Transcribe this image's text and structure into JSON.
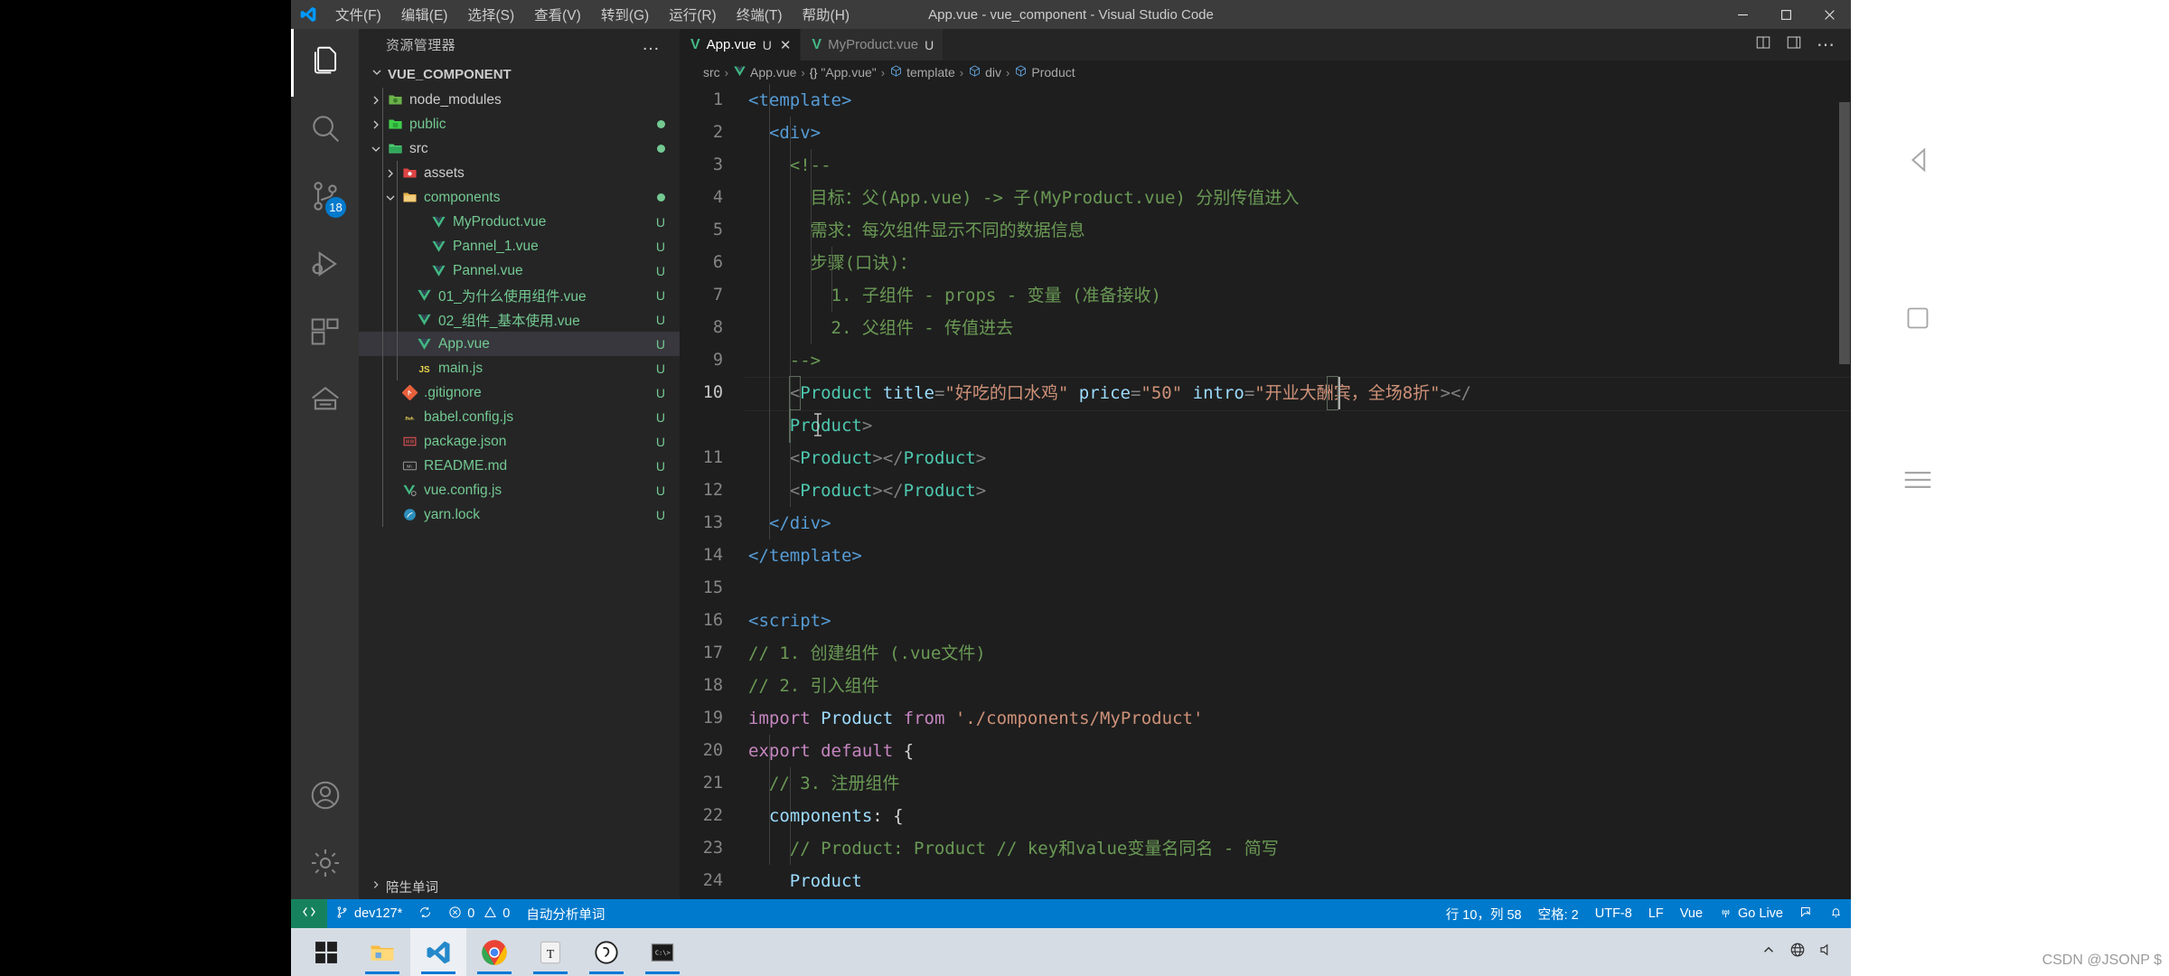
{
  "window": {
    "title": "App.vue - vue_component - Visual Studio Code",
    "menus": [
      "文件(F)",
      "编辑(E)",
      "选择(S)",
      "查看(V)",
      "转到(G)",
      "运行(R)",
      "终端(T)",
      "帮助(H)"
    ],
    "controls": {
      "minimize": "minimize-icon",
      "maximize": "maximize-icon",
      "close": "close-icon"
    }
  },
  "activitybar": {
    "items": [
      {
        "name": "explorer",
        "icon": "files-icon",
        "badge": ""
      },
      {
        "name": "search",
        "icon": "search-icon",
        "badge": ""
      },
      {
        "name": "source-control",
        "icon": "source-control-icon",
        "badge": "18"
      },
      {
        "name": "run-and-debug",
        "icon": "debug-icon",
        "badge": ""
      },
      {
        "name": "extensions",
        "icon": "extensions-icon",
        "badge": ""
      },
      {
        "name": "remote-explorer",
        "icon": "remote-icon",
        "badge": ""
      }
    ],
    "bottom": [
      {
        "name": "accounts",
        "icon": "account-icon"
      },
      {
        "name": "settings",
        "icon": "gear-icon"
      }
    ]
  },
  "sidebar": {
    "header": "资源管理器",
    "more": "…",
    "section": "VUE_COMPONENT",
    "footer": "陪生单词",
    "tree": [
      {
        "label": "node_modules",
        "indent": 1,
        "icon": "folder-node",
        "twisty": "right",
        "badge": "",
        "kind": "folder"
      },
      {
        "label": "public",
        "indent": 1,
        "icon": "folder-public",
        "twisty": "right",
        "badge": "dot",
        "kind": "folder"
      },
      {
        "label": "src",
        "indent": 1,
        "icon": "folder-src",
        "twisty": "down",
        "badge": "dot",
        "kind": "folder"
      },
      {
        "label": "assets",
        "indent": 2,
        "icon": "folder-assets",
        "twisty": "right",
        "badge": "",
        "kind": "folder"
      },
      {
        "label": "components",
        "indent": 2,
        "icon": "folder-components",
        "twisty": "down",
        "badge": "dot",
        "kind": "folder"
      },
      {
        "label": "MyProduct.vue",
        "indent": 4,
        "icon": "vue-icon",
        "twisty": "",
        "badge": "U",
        "kind": "file"
      },
      {
        "label": "Pannel_1.vue",
        "indent": 4,
        "icon": "vue-icon",
        "twisty": "",
        "badge": "U",
        "kind": "file"
      },
      {
        "label": "Pannel.vue",
        "indent": 4,
        "icon": "vue-icon",
        "twisty": "",
        "badge": "U",
        "kind": "file"
      },
      {
        "label": "01_为什么使用组件.vue",
        "indent": 3,
        "icon": "vue-icon",
        "twisty": "",
        "badge": "U",
        "kind": "file"
      },
      {
        "label": "02_组件_基本使用.vue",
        "indent": 3,
        "icon": "vue-icon",
        "twisty": "",
        "badge": "U",
        "kind": "file"
      },
      {
        "label": "App.vue",
        "indent": 3,
        "icon": "vue-icon",
        "twisty": "",
        "badge": "U",
        "kind": "file",
        "selected": true
      },
      {
        "label": "main.js",
        "indent": 3,
        "icon": "js-icon",
        "twisty": "",
        "badge": "U",
        "kind": "file"
      },
      {
        "label": ".gitignore",
        "indent": 2,
        "icon": "git-icon",
        "twisty": "",
        "badge": "U",
        "kind": "file"
      },
      {
        "label": "babel.config.js",
        "indent": 2,
        "icon": "babel-icon",
        "twisty": "",
        "badge": "U",
        "kind": "file"
      },
      {
        "label": "package.json",
        "indent": 2,
        "icon": "json-icon",
        "twisty": "",
        "badge": "U",
        "kind": "file"
      },
      {
        "label": "README.md",
        "indent": 2,
        "icon": "markdown-icon",
        "twisty": "",
        "badge": "U",
        "kind": "file"
      },
      {
        "label": "vue.config.js",
        "indent": 2,
        "icon": "vue-config-icon",
        "twisty": "",
        "badge": "U",
        "kind": "file"
      },
      {
        "label": "yarn.lock",
        "indent": 2,
        "icon": "yarn-icon",
        "twisty": "",
        "badge": "U",
        "kind": "file"
      }
    ]
  },
  "editor": {
    "tabs": [
      {
        "label": "App.vue",
        "badge": "U",
        "icon": "vue-icon",
        "active": true,
        "close": "✕"
      },
      {
        "label": "MyProduct.vue",
        "badge": "U",
        "icon": "vue-icon",
        "active": false,
        "close": ""
      }
    ],
    "tab_actions": [
      "split-editor-icon",
      "layout-panel-icon",
      "more-actions-icon"
    ],
    "breadcrumb": [
      "src",
      "App.vue",
      "{} \"App.vue\"",
      "template",
      "div",
      "Product"
    ],
    "lines": [
      {
        "n": 1,
        "tokens": [
          {
            "t": "tag",
            "v": "<template>"
          }
        ]
      },
      {
        "n": 2,
        "tokens": [
          {
            "t": "plain",
            "v": "  "
          },
          {
            "t": "tag",
            "v": "<div>"
          }
        ]
      },
      {
        "n": 3,
        "tokens": [
          {
            "t": "plain",
            "v": "    "
          },
          {
            "t": "comment",
            "v": "<!--"
          }
        ]
      },
      {
        "n": 4,
        "tokens": [
          {
            "t": "plain",
            "v": "      "
          },
          {
            "t": "comment",
            "v": "目标：父(App.vue) -> 子(MyProduct.vue) 分别传值进入"
          }
        ]
      },
      {
        "n": 5,
        "tokens": [
          {
            "t": "plain",
            "v": "      "
          },
          {
            "t": "comment",
            "v": "需求：每次组件显示不同的数据信息"
          }
        ]
      },
      {
        "n": 6,
        "tokens": [
          {
            "t": "plain",
            "v": "      "
          },
          {
            "t": "comment",
            "v": "步骤(口诀)："
          }
        ]
      },
      {
        "n": 7,
        "tokens": [
          {
            "t": "plain",
            "v": "        "
          },
          {
            "t": "comment",
            "v": "1. 子组件 - props - 变量 (准备接收)"
          }
        ]
      },
      {
        "n": 8,
        "tokens": [
          {
            "t": "plain",
            "v": "        "
          },
          {
            "t": "comment",
            "v": "2. 父组件 - 传值进去"
          }
        ]
      },
      {
        "n": 9,
        "tokens": [
          {
            "t": "plain",
            "v": "    "
          },
          {
            "t": "comment",
            "v": "-->"
          }
        ]
      },
      {
        "n": 10,
        "highlight": true,
        "wrapped": true,
        "tokens": [
          {
            "t": "plain",
            "v": "    "
          },
          {
            "t": "punct",
            "v": "<"
          },
          {
            "t": "comp",
            "v": "Product"
          },
          {
            "t": "plain",
            "v": " "
          },
          {
            "t": "attr",
            "v": "title"
          },
          {
            "t": "punct",
            "v": "="
          },
          {
            "t": "str",
            "v": "\"好吃的口水鸡\""
          },
          {
            "t": "plain",
            "v": " "
          },
          {
            "t": "attr",
            "v": "price"
          },
          {
            "t": "punct",
            "v": "="
          },
          {
            "t": "str",
            "v": "\"50\""
          },
          {
            "t": "plain",
            "v": " "
          },
          {
            "t": "attr",
            "v": "intro"
          },
          {
            "t": "punct",
            "v": "="
          },
          {
            "t": "str",
            "v": "\"开业大酬宾，全场8折\""
          },
          {
            "t": "punct",
            "v": ">"
          },
          {
            "t": "punct",
            "v": "</"
          }
        ],
        "wrap_tokens": [
          {
            "t": "plain",
            "v": "    "
          },
          {
            "t": "comp",
            "v": "Product"
          },
          {
            "t": "punct",
            "v": ">"
          }
        ]
      },
      {
        "n": 11,
        "tokens": [
          {
            "t": "plain",
            "v": "    "
          },
          {
            "t": "punct",
            "v": "<"
          },
          {
            "t": "comp",
            "v": "Product"
          },
          {
            "t": "punct",
            "v": "></"
          },
          {
            "t": "comp",
            "v": "Product"
          },
          {
            "t": "punct",
            "v": ">"
          }
        ]
      },
      {
        "n": 12,
        "tokens": [
          {
            "t": "plain",
            "v": "    "
          },
          {
            "t": "punct",
            "v": "<"
          },
          {
            "t": "comp",
            "v": "Product"
          },
          {
            "t": "punct",
            "v": "></"
          },
          {
            "t": "comp",
            "v": "Product"
          },
          {
            "t": "punct",
            "v": ">"
          }
        ]
      },
      {
        "n": 13,
        "tokens": [
          {
            "t": "plain",
            "v": "  "
          },
          {
            "t": "tag",
            "v": "</div>"
          }
        ]
      },
      {
        "n": 14,
        "tokens": [
          {
            "t": "tag",
            "v": "</template>"
          }
        ]
      },
      {
        "n": 15,
        "tokens": []
      },
      {
        "n": 16,
        "tokens": [
          {
            "t": "tag",
            "v": "<script>"
          }
        ]
      },
      {
        "n": 17,
        "tokens": [
          {
            "t": "comment",
            "v": "// 1. 创建组件 (.vue文件)"
          }
        ]
      },
      {
        "n": 18,
        "tokens": [
          {
            "t": "comment",
            "v": "// 2. 引入组件"
          }
        ]
      },
      {
        "n": 19,
        "tokens": [
          {
            "t": "kw",
            "v": "import"
          },
          {
            "t": "plain",
            "v": " "
          },
          {
            "t": "prop",
            "v": "Product"
          },
          {
            "t": "plain",
            "v": " "
          },
          {
            "t": "kw",
            "v": "from"
          },
          {
            "t": "plain",
            "v": " "
          },
          {
            "t": "str",
            "v": "'./components/MyProduct'"
          }
        ]
      },
      {
        "n": 20,
        "tokens": [
          {
            "t": "kw",
            "v": "export"
          },
          {
            "t": "plain",
            "v": " "
          },
          {
            "t": "kw",
            "v": "default"
          },
          {
            "t": "plain",
            "v": " {"
          }
        ]
      },
      {
        "n": 21,
        "tokens": [
          {
            "t": "plain",
            "v": "  "
          },
          {
            "t": "comment",
            "v": "// 3. 注册组件"
          }
        ]
      },
      {
        "n": 22,
        "tokens": [
          {
            "t": "plain",
            "v": "  "
          },
          {
            "t": "prop",
            "v": "components"
          },
          {
            "t": "plain",
            "v": ": {"
          }
        ]
      },
      {
        "n": 23,
        "tokens": [
          {
            "t": "plain",
            "v": "    "
          },
          {
            "t": "comment",
            "v": "// Product: Product // key和value变量名同名 - 简写"
          }
        ]
      },
      {
        "n": 24,
        "tokens": [
          {
            "t": "plain",
            "v": "    "
          },
          {
            "t": "prop",
            "v": "Product"
          }
        ]
      }
    ]
  },
  "statusbar": {
    "remote_icon": "remote-window-icon",
    "branch": "dev127*",
    "sync_icon": "sync-icon",
    "errors": "0",
    "warnings": "0",
    "analyze": "自动分析单词",
    "right": {
      "position": "行 10，列 58",
      "spaces": "空格: 2",
      "encoding": "UTF-8",
      "eol": "LF",
      "language": "Vue",
      "golive": "Go Live",
      "feedback_icon": "feedback-icon",
      "bell_icon": "bell-icon"
    }
  },
  "taskbar": {
    "items": [
      {
        "name": "start-button",
        "icon": "windows-icon",
        "active": false,
        "running": false
      },
      {
        "name": "file-explorer",
        "icon": "folder-icon",
        "active": false,
        "running": true
      },
      {
        "name": "vscode",
        "icon": "vscode-icon",
        "active": true,
        "running": true
      },
      {
        "name": "chrome",
        "icon": "chrome-icon",
        "active": false,
        "running": true
      },
      {
        "name": "typora",
        "icon": "typora-icon",
        "active": false,
        "running": true
      },
      {
        "name": "snipaste",
        "icon": "snipaste-icon",
        "active": false,
        "running": true
      },
      {
        "name": "terminal",
        "icon": "terminal-icon",
        "active": false,
        "running": true
      }
    ],
    "tray": [
      "chevron-up-icon",
      "network-icon",
      "volume-icon"
    ]
  },
  "desktop": {
    "right_icons": [
      "back-triangle-icon",
      "square-icon",
      "hamburger-icon"
    ],
    "watermark": "CSDN @JSONP $"
  },
  "colors": {
    "accent": "#007acc",
    "remote": "#16825d",
    "titlebar": "#3c3c3c",
    "sidebar": "#252526",
    "editor": "#1e1e1e",
    "activitybar": "#333333",
    "vue_green": "#41b883",
    "badge_green": "#73c991"
  }
}
